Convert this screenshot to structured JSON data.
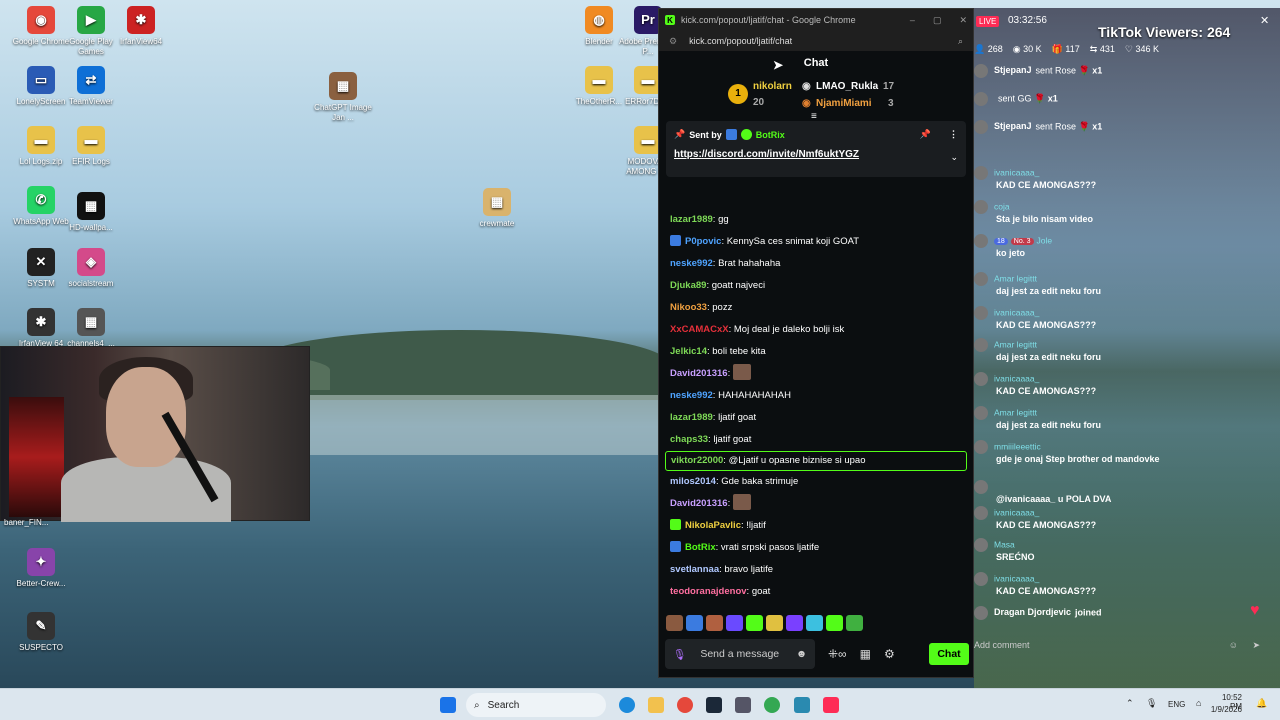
{
  "desktop": {
    "icons": [
      {
        "label": "Google Chrome",
        "glyph": "◉",
        "color": "#e5483b"
      },
      {
        "label": "Google Play Games",
        "glyph": "▶",
        "color": "#27a745"
      },
      {
        "label": "IrfanView64",
        "glyph": "✱",
        "color": "#c22"
      },
      {
        "label": "Blender",
        "glyph": "◍",
        "color": "#f08a22"
      },
      {
        "label": "Adobe Premiere P...",
        "glyph": "Pr",
        "color": "#2a1a66"
      },
      {
        "label": "LonelyScreen",
        "glyph": "▭",
        "color": "#2a5bb5"
      },
      {
        "label": "TeamViewer",
        "glyph": "⇄",
        "color": "#0e6fd6"
      },
      {
        "label": "ChatGPT Image Jan ...",
        "glyph": "▦",
        "color": "#8a6040"
      },
      {
        "label": "TheOtherR...",
        "glyph": "▬",
        "color": "#e8c24a"
      },
      {
        "label": "ERRor7DZ...",
        "glyph": "▬",
        "color": "#e8c24a"
      },
      {
        "label": "Lol Logs.zip",
        "glyph": "▬",
        "color": "#e8c24a"
      },
      {
        "label": "EFIR Logs",
        "glyph": "▬",
        "color": "#e8c24a"
      },
      {
        "label": "MODOVAN AMONG US",
        "glyph": "▬",
        "color": "#e8c24a"
      },
      {
        "label": "WhatsApp Web",
        "glyph": "✆",
        "color": "#25d366"
      },
      {
        "label": "HD-wallpa...",
        "glyph": "▦",
        "color": "#111"
      },
      {
        "label": "crewmate",
        "glyph": "▦",
        "color": "#d9b36c"
      },
      {
        "label": "SYSTM",
        "glyph": "✕",
        "color": "#222"
      },
      {
        "label": "socialstream",
        "glyph": "◈",
        "color": "#d44a8a"
      },
      {
        "label": "IrfanView 64",
        "glyph": "✱",
        "color": "#333"
      },
      {
        "label": "channels4_...",
        "glyph": "▦",
        "color": "#555"
      },
      {
        "label": "Better-Crew...",
        "glyph": "✦",
        "color": "#8844aa"
      },
      {
        "label": "SUSPECTO",
        "glyph": "✎",
        "color": "#333"
      }
    ],
    "webcam_label": "baner_FIN..."
  },
  "browser": {
    "title": "kick.com/popout/ljatif/chat - Google Chrome",
    "url": "kick.com/popout/ljatif/chat",
    "chat_title": "Chat",
    "leaderboard": [
      {
        "rank": "1",
        "name": "nikolarn",
        "count": "20"
      },
      {
        "name": "LMAO_Rukla",
        "count": "17"
      },
      {
        "name": "NjamiMiami",
        "count": "3"
      }
    ],
    "pinned": {
      "sent_by": "Sent by",
      "sender": "BotRix",
      "link": "https://discord.com/invite/Nmf6uktYGZ"
    },
    "messages": [
      {
        "user": "lazar1989",
        "text": "gg",
        "color": "#7ed957"
      },
      {
        "user": "P0povic",
        "text": "KennySa ces snimat koji GOAT",
        "color": "#4fa3ff",
        "badge": "#3b7be0"
      },
      {
        "user": "neske992",
        "text": "Brat hahahaha",
        "color": "#4fa3ff"
      },
      {
        "user": "Djuka89",
        "text": "goatt najveci",
        "color": "#7ed957"
      },
      {
        "user": "Nikoo33",
        "text": "pozz",
        "color": "#f0a040"
      },
      {
        "user": "XxCAMACxX",
        "text": "Moj deal je daleko bolji isk",
        "color": "#e5303a"
      },
      {
        "user": "Jelkic14",
        "text": "boli tebe kita",
        "color": "#7ed957"
      },
      {
        "user": "David201316",
        "text": "",
        "color": "#c9a0ff",
        "emote": true
      },
      {
        "user": "neske992",
        "text": "HAHAHAHAHAH",
        "color": "#4fa3ff"
      },
      {
        "user": "lazar1989",
        "text": "ljatif goat",
        "color": "#7ed957"
      },
      {
        "user": "chaps33",
        "text": "ljatif goat",
        "color": "#7ed957"
      },
      {
        "user": "viktor22000",
        "text": "@Ljatif u opasne biznise si upao",
        "color": "#7ed957",
        "highlight": true
      },
      {
        "user": "milos2014",
        "text": "Gde baka strimuje",
        "color": "#b0c8ff"
      },
      {
        "user": "David201316",
        "text": "",
        "color": "#c9a0ff",
        "emote": true
      },
      {
        "user": "NikolaPavlic",
        "text": "!ljatif",
        "color": "#f0d040",
        "badge": "#53fc18"
      },
      {
        "user": "BotRix",
        "text": "vrati srpski pasos ljatife",
        "color": "#53fc18",
        "badge": "#3b7be0"
      },
      {
        "user": "svetlannaa",
        "text": "bravo ljatife",
        "color": "#b0c8ff"
      },
      {
        "user": "teodoranajdenov",
        "text": "goat",
        "color": "#ff6fa0"
      }
    ],
    "input_placeholder": "Send a message",
    "send_label": "Chat"
  },
  "tiktok": {
    "live": "LIVE",
    "timer": "03:32:56",
    "viewers": "TikTok Viewers: 264",
    "stats": [
      "268",
      "30 K",
      "117",
      "431",
      "346 K"
    ],
    "feed": [
      {
        "name": "StjepanJ",
        "msg": "sent Rose",
        "mult": "x1",
        "gift": true
      },
      {
        "name": "",
        "msg": "sent GG",
        "mult": "x1",
        "gift": true
      },
      {
        "name": "StjepanJ",
        "msg": "sent Rose",
        "mult": "x1",
        "gift": true
      },
      {
        "name": "ivanicaaaa_",
        "msg": "KAD CE AMONGAS???"
      },
      {
        "name": "coja",
        "msg": "Sta je bilo nisam video"
      },
      {
        "name": "Jole",
        "msg": "ko jeto",
        "badges": [
          "18",
          "No. 3"
        ]
      },
      {
        "name": "Amar legittt",
        "msg": "daj jest za edit neku foru"
      },
      {
        "name": "ivanicaaaa_",
        "msg": "KAD CE AMONGAS???"
      },
      {
        "name": "Amar legittt",
        "msg": "daj jest za edit neku foru"
      },
      {
        "name": "ivanicaaaa_",
        "msg": "KAD CE AMONGAS???"
      },
      {
        "name": "Amar legittt",
        "msg": "daj jest za edit neku foru"
      },
      {
        "name": "mmiiileeettic",
        "msg": "gde je onaj Step brother od mandovke"
      },
      {
        "name": "",
        "msg": "@ivanicaaaa_ u POLA DVA"
      },
      {
        "name": "ivanicaaaa_",
        "msg": "KAD CE AMONGAS???"
      },
      {
        "name": "Masa",
        "msg": "SREĆNO"
      },
      {
        "name": "ivanicaaaa_",
        "msg": "KAD CE AMONGAS???"
      },
      {
        "name": "Dragan Djordjevic",
        "msg": "joined",
        "join": true
      }
    ],
    "comment_placeholder": "Add comment"
  },
  "taskbar": {
    "search": "Search",
    "lang": "ENG",
    "time": "10:52 PM",
    "date": "1/9/2026"
  }
}
